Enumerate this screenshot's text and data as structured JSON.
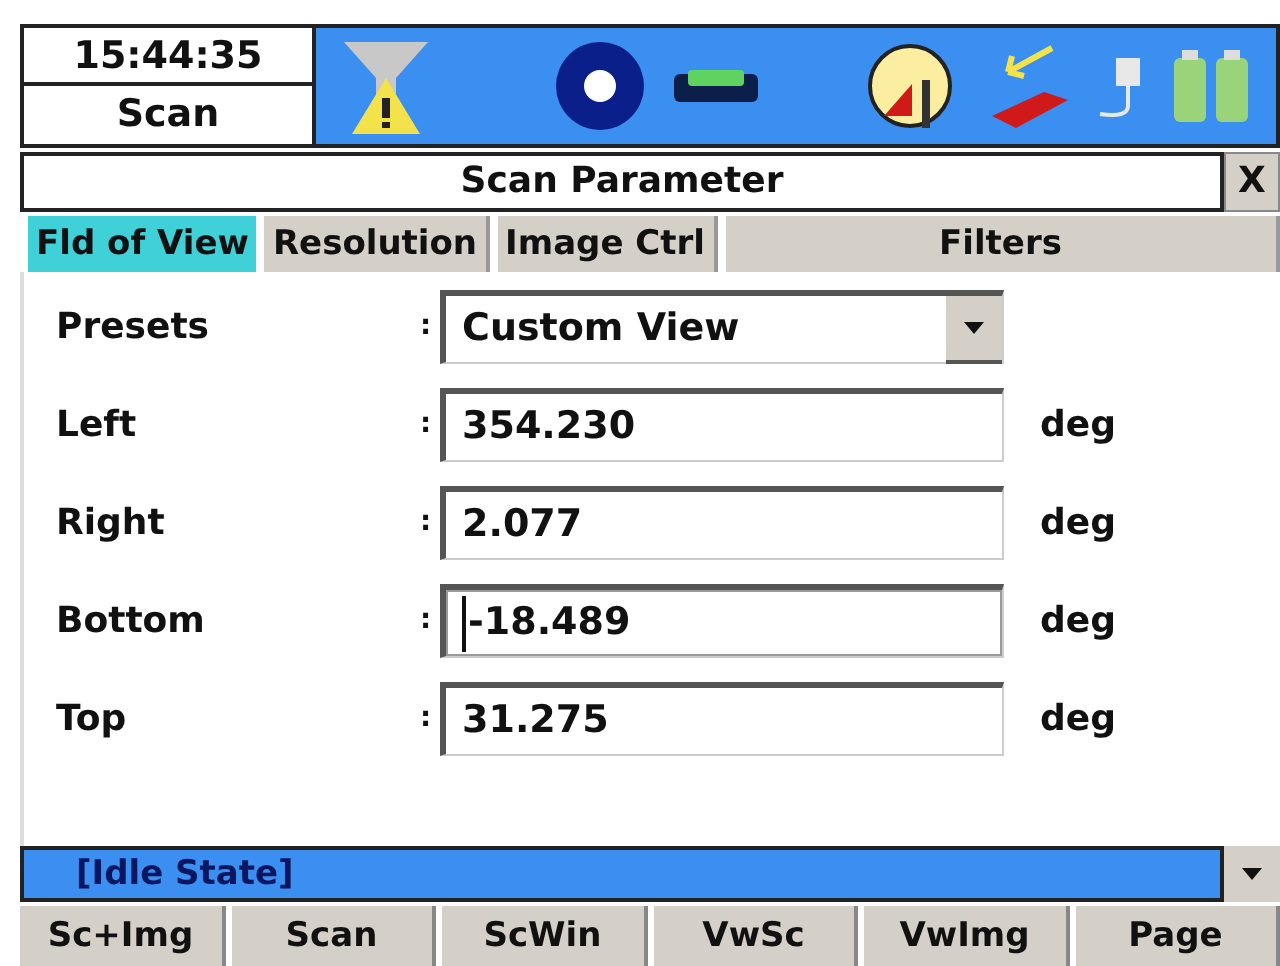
{
  "header": {
    "time": "15:44:35",
    "mode": "Scan"
  },
  "dialog": {
    "title": "Scan Parameter",
    "close": "X"
  },
  "tabs": [
    {
      "label": "Fld of View",
      "selected": true
    },
    {
      "label": "Resolution",
      "selected": false
    },
    {
      "label": "Image Ctrl",
      "selected": false
    },
    {
      "label": "Filters",
      "selected": false
    }
  ],
  "fields": [
    {
      "kind": "dropdown",
      "label": "Presets",
      "separator": ":",
      "value": "Custom View",
      "focused": false
    },
    {
      "kind": "number",
      "label": "Left",
      "separator": ":",
      "value": "354.230",
      "unit": "deg",
      "focused": false
    },
    {
      "kind": "number",
      "label": "Right",
      "separator": ":",
      "value": "2.077",
      "unit": "deg",
      "focused": false
    },
    {
      "kind": "number",
      "label": "Bottom",
      "separator": ":",
      "value": "-18.489",
      "unit": "deg",
      "focused": true
    },
    {
      "kind": "number",
      "label": "Top",
      "separator": ":",
      "value": "31.275",
      "unit": "deg",
      "focused": false
    }
  ],
  "status_bar": {
    "text": "[Idle State]"
  },
  "softkeys": [
    "Sc+Img",
    "Scan",
    "ScWin",
    "VwSc",
    "VwImg",
    "Page"
  ]
}
